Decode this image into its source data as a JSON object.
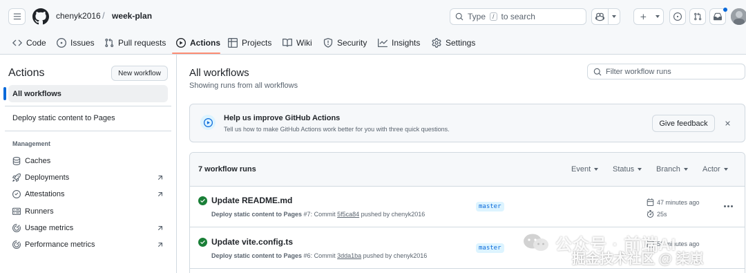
{
  "header": {
    "owner": "chenyk2016",
    "separator": "/",
    "repo": "week-plan",
    "search_placeholder": "Type",
    "search_key": "/",
    "search_suffix": "to search"
  },
  "repo_nav": {
    "tabs": [
      {
        "label": "Code",
        "icon": "code-icon"
      },
      {
        "label": "Issues",
        "icon": "issue-opened-icon"
      },
      {
        "label": "Pull requests",
        "icon": "git-pull-request-icon"
      },
      {
        "label": "Actions",
        "icon": "play-icon",
        "active": true
      },
      {
        "label": "Projects",
        "icon": "table-icon"
      },
      {
        "label": "Wiki",
        "icon": "book-icon"
      },
      {
        "label": "Security",
        "icon": "shield-icon"
      },
      {
        "label": "Insights",
        "icon": "graph-icon"
      },
      {
        "label": "Settings",
        "icon": "gear-icon"
      }
    ]
  },
  "sidebar": {
    "title": "Actions",
    "new_workflow_label": "New workflow",
    "all_workflows_label": "All workflows",
    "workflows": [
      "Deploy static content to Pages"
    ],
    "group_label": "Management",
    "management_items": [
      {
        "label": "Caches",
        "icon": "database-icon",
        "external": false
      },
      {
        "label": "Deployments",
        "icon": "rocket-icon",
        "external": true
      },
      {
        "label": "Attestations",
        "icon": "verified-icon",
        "external": true
      },
      {
        "label": "Runners",
        "icon": "server-icon",
        "external": false
      },
      {
        "label": "Usage metrics",
        "icon": "meter-icon",
        "external": true
      },
      {
        "label": "Performance metrics",
        "icon": "meter-icon",
        "external": true
      }
    ]
  },
  "main": {
    "title": "All workflows",
    "subtitle": "Showing runs from all workflows",
    "filter_placeholder": "Filter workflow runs",
    "banner": {
      "title": "Help us improve GitHub Actions",
      "description": "Tell us how to make GitHub Actions work better for you with three quick questions.",
      "feedback_label": "Give feedback"
    },
    "runs": {
      "count_label": "7 workflow runs",
      "filters": [
        "Event",
        "Status",
        "Branch",
        "Actor"
      ],
      "items": [
        {
          "title": "Update README.md",
          "workflow": "Deploy static content to Pages",
          "run_number": "#7",
          "commit_label": "Commit",
          "sha": "5f5ca84",
          "pushed_by": "pushed by chenyk2016",
          "branch": "master",
          "time_ago": "47 minutes ago",
          "duration": "25s",
          "status": "success"
        },
        {
          "title": "Update vite.config.ts",
          "workflow": "Deploy static content to Pages",
          "run_number": "#6",
          "commit_label": "Commit",
          "sha": "3dda1ba",
          "pushed_by": "pushed by chenyk2016",
          "branch": "master",
          "time_ago": "52 minutes ago",
          "duration": "",
          "status": "success"
        }
      ]
    }
  },
  "watermark": {
    "line1": "公众号 · 前端AI",
    "line2": "掘金技术社区 @ 柒崽"
  },
  "colors": {
    "accent": "#0969da",
    "success": "#1a7f37",
    "tab_underline": "#fd8c73",
    "border": "#d1d9e0",
    "muted_text": "#59636e"
  }
}
